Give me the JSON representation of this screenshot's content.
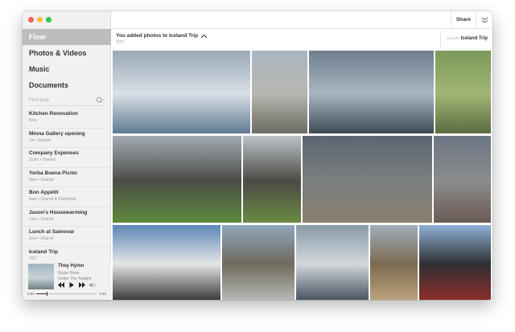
{
  "nav": [
    {
      "label": "Flow",
      "active": true
    },
    {
      "label": "Photos & Videos",
      "active": false
    },
    {
      "label": "Music",
      "active": false
    },
    {
      "label": "Documents",
      "active": false
    }
  ],
  "search": {
    "placeholder": "Find loop"
  },
  "albums": [
    {
      "title": "Kitchen Renovation",
      "meta": "Now"
    },
    {
      "title": "Minna Gallery opening",
      "meta": "1w • Shared"
    },
    {
      "title": "Company Expenses",
      "meta": "11am • Shared"
    },
    {
      "title": "Yerba Buena Picnic",
      "meta": "9am • Shared"
    },
    {
      "title": "Bon Appétit",
      "meta": "4am • Shared & Published"
    },
    {
      "title": "Jason's Housewarming",
      "meta": "1mo • Shared"
    },
    {
      "title": "Lunch at Samovar",
      "meta": "1mo • Shared"
    },
    {
      "title": "Iceland Trip",
      "meta": "7/27"
    }
  ],
  "player": {
    "track": "They Hymn",
    "artist": "Sugar Rose",
    "album": "Under The Twilight",
    "time_elapsed": "0:24",
    "time_remaining": "3:57",
    "progress": 0.17
  },
  "toolbar": {
    "share_label": "Share"
  },
  "header": {
    "title": "You added photos to Iceland Trip",
    "date": "7/27",
    "loop_label": "LOOP",
    "loop_name": "Iceland Trip"
  },
  "photos": [
    {
      "subject": "glacier lagoon with iceberg",
      "colors": [
        "#9aa8b6",
        "#d9e0e6",
        "#5f7a92"
      ]
    },
    {
      "subject": "Reykjavik town from above",
      "colors": [
        "#aab6c2",
        "#b7b7b0",
        "#6b6b63"
      ]
    },
    {
      "subject": "waterfall and river",
      "colors": [
        "#6f7f8f",
        "#a9b6c0",
        "#3d4a52"
      ]
    },
    {
      "subject": "green hillside with hiker",
      "colors": [
        "#7a9a5a",
        "#a3b574",
        "#5b6b43"
      ]
    },
    {
      "subject": "lava canyon path",
      "colors": [
        "#a3aab2",
        "#4a4d48",
        "#5d8a3a"
      ]
    },
    {
      "subject": "narrow gorge",
      "colors": [
        "#bcc3c8",
        "#4c4a45",
        "#6a8a44"
      ]
    },
    {
      "subject": "stormy coast",
      "colors": [
        "#5c6570",
        "#7a7f80",
        "#8b7d70"
      ]
    },
    {
      "subject": "geothermal steam",
      "colors": [
        "#6c7683",
        "#8a8c8d",
        "#6b5a52"
      ]
    },
    {
      "subject": "town house under blue sky",
      "colors": [
        "#5b87b8",
        "#e6e6e6",
        "#3c3c3c"
      ]
    },
    {
      "subject": "flat plain and mountains",
      "colors": [
        "#8ea6bd",
        "#6f6a5c",
        "#b6b7b5"
      ]
    },
    {
      "subject": "glacier fjord",
      "colors": [
        "#8999a8",
        "#d2d8dc",
        "#4a5561"
      ]
    },
    {
      "subject": "gravel road and field",
      "colors": [
        "#a1aebb",
        "#7c6a50",
        "#b9a27a"
      ]
    },
    {
      "subject": "black house",
      "colors": [
        "#8fb1d7",
        "#2e2f33",
        "#8a2f2a"
      ]
    }
  ]
}
